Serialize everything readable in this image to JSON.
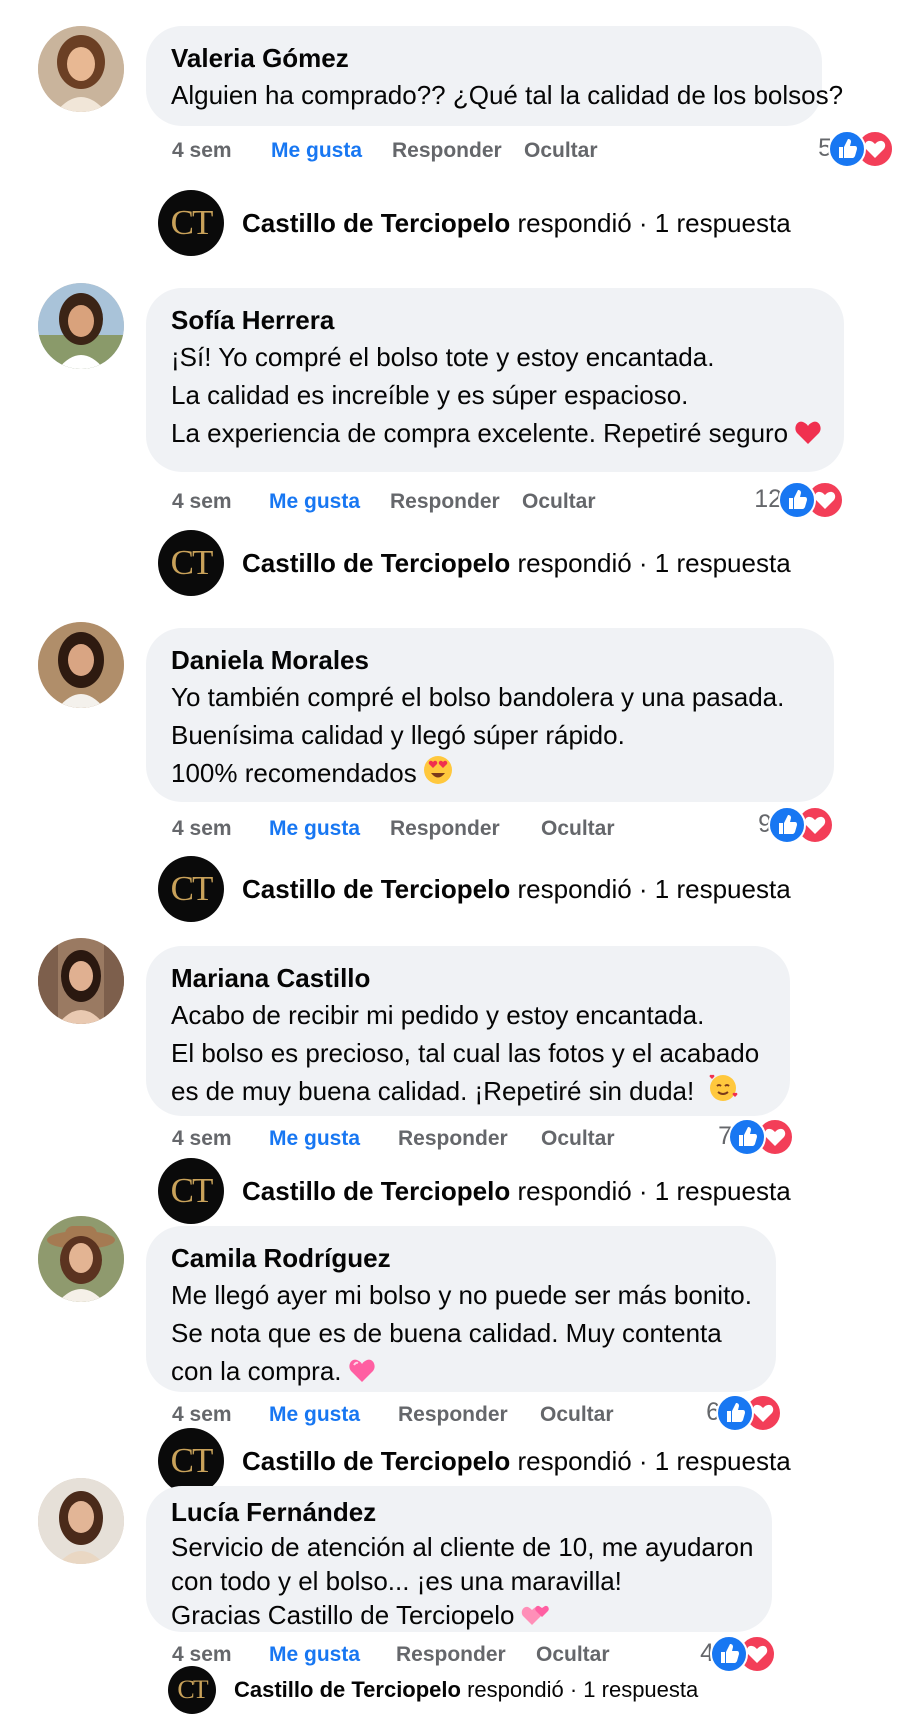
{
  "colors": {
    "bubble": "#f0f2f5",
    "link_blue": "#1877f2",
    "meta_gray": "#65676b",
    "heart_red": "#f33e58",
    "logo_gold": "#c9a25a"
  },
  "page": {
    "brand_initials": "CT",
    "brand_name": "Castillo de Terciopelo",
    "replied_text": "respondió · 1 respuesta"
  },
  "actions": {
    "time": "4 sem",
    "like": "Me gusta",
    "reply": "Responder",
    "hide": "Ocultar"
  },
  "comments": [
    {
      "author": "Valeria Gómez",
      "lines": [
        "Alguien ha comprado?? ¿Qué tal la calidad de los bolsos?"
      ],
      "emoji": "",
      "reactions": "5"
    },
    {
      "author": "Sofía Herrera",
      "lines": [
        "¡Sí! Yo compré el bolso tote y estoy encantada.",
        "La calidad es increíble y es súper espacioso.",
        "La experiencia de compra excelente. Repetiré seguro"
      ],
      "emoji": "heart",
      "reactions": "12"
    },
    {
      "author": "Daniela Morales",
      "lines": [
        "Yo también compré el bolso bandolera y una pasada.",
        "Buenísima calidad y llegó súper rápido.",
        "100% recomendados"
      ],
      "emoji": "heart-eyes",
      "reactions": "9"
    },
    {
      "author": "Mariana Castillo",
      "lines": [
        "Acabo de recibir mi pedido y estoy encantada.",
        "El bolso es precioso, tal cual las fotos y el acabado",
        "es de muy buena calidad. ¡Repetiré sin duda!"
      ],
      "emoji": "smiling-hearts",
      "reactions": "7"
    },
    {
      "author": "Camila Rodríguez",
      "lines": [
        "Me llegó ayer mi bolso y no puede ser más bonito.",
        "Se nota que es de buena calidad. Muy contenta",
        "con la compra."
      ],
      "emoji": "pink-heart",
      "reactions": "6"
    },
    {
      "author": "Lucía Fernández",
      "lines": [
        "Servicio de atención al cliente de 10, me ayudaron",
        "con todo y el bolso... ¡es una maravilla!",
        "Gracias Castillo de Terciopelo"
      ],
      "emoji": "pink-hearts",
      "reactions": "4"
    }
  ]
}
